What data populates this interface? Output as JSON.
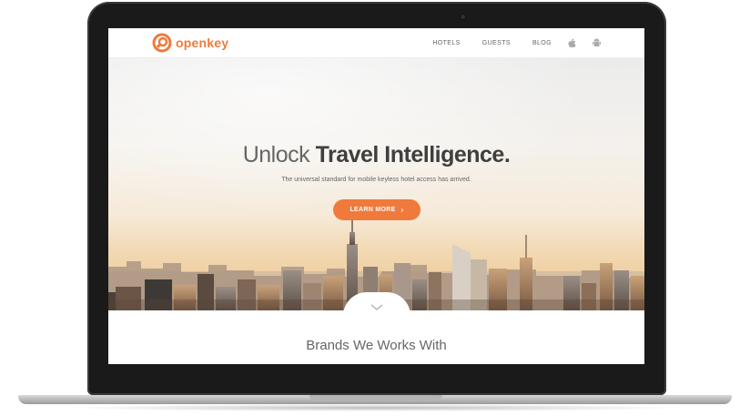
{
  "brand": {
    "name": "openkey",
    "accent_color": "#f07a3c"
  },
  "nav": {
    "links": [
      "HOTELS",
      "GUESTS",
      "BLOG"
    ],
    "icons": [
      "apple-icon",
      "android-icon"
    ]
  },
  "hero": {
    "headline_light": "Unlock",
    "headline_bold": "Travel Intelligence.",
    "subtitle": "The universal standard for mobile keyless hotel access has arrived.",
    "cta_label": "LEARN MORE",
    "cta_icon": "chevron-right-icon"
  },
  "brands": {
    "title": "Brands We Works With"
  },
  "scroll_icon": "chevron-down-icon"
}
